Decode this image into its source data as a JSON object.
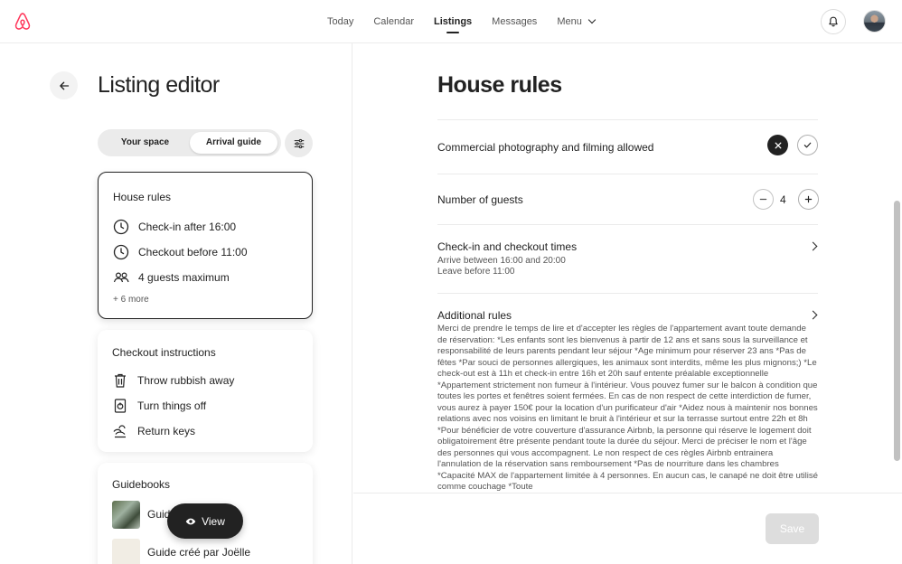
{
  "topbar": {
    "nav": [
      {
        "label": "Today",
        "active": false
      },
      {
        "label": "Calendar",
        "active": false
      },
      {
        "label": "Listings",
        "active": true
      },
      {
        "label": "Messages",
        "active": false
      },
      {
        "label": "Menu",
        "active": false
      }
    ],
    "logo_icon": "airbnb-logo-icon",
    "brand_color": "#FF385C",
    "bell_icon": "bell-icon"
  },
  "left": {
    "title": "Listing editor",
    "tabs": {
      "your_space": "Your space",
      "arrival_guide": "Arrival guide",
      "selected": "Arrival guide"
    },
    "house_rules_card": {
      "title": "House rules",
      "items": [
        {
          "icon": "clock-icon",
          "label": "Check-in after 16:00"
        },
        {
          "icon": "clock-icon",
          "label": "Checkout before 11:00"
        },
        {
          "icon": "guests-icon",
          "label": "4 guests maximum"
        }
      ],
      "more": "+ 6 more"
    },
    "checkout_card": {
      "title": "Checkout instructions",
      "items": [
        {
          "icon": "trash-icon",
          "label": "Throw rubbish away"
        },
        {
          "icon": "power-icon",
          "label": "Turn things off"
        },
        {
          "icon": "keys-icon",
          "label": "Return keys"
        }
      ]
    },
    "guidebooks_card": {
      "title": "Guidebooks",
      "items": [
        {
          "label": "Guid"
        },
        {
          "label": "Guide créé par Joëlle"
        }
      ]
    },
    "view_button": "View"
  },
  "right": {
    "title": "House rules",
    "photography": {
      "label": "Commercial photography and filming allowed",
      "value": "not allowed"
    },
    "guests": {
      "label": "Number of guests",
      "value": "4"
    },
    "times": {
      "label": "Check-in and checkout times",
      "line1": "Arrive between 16:00 and 20:00",
      "line2": "Leave before 11:00"
    },
    "additional": {
      "label": "Additional rules",
      "text": "Merci de prendre le temps de lire et d'accepter les règles de l'appartement avant toute demande de réservation: *Les enfants sont les bienvenus à partir de 12 ans et sans sous la surveillance et responsabilité de leurs parents pendant leur séjour *Age minimum pour réserver 23 ans *Pas de fêtes *Par souci de personnes allergiques, les animaux sont interdits, même les plus mignons;) *Le check-out est à 11h et check-in entre 16h et 20h sauf entente préalable exceptionnelle *Appartement strictement non fumeur à l'intérieur. Vous pouvez fumer sur le balcon à condition que toutes les portes et fenêtres soient fermées. En cas de non respect de cette interdiction de fumer, vous aurez à payer 150€ pour la location d'un purificateur d'air *Aidez nous à maintenir nos bonnes relations avec nos voisins en limitant le bruit à l'intérieur et sur la terrasse surtout entre 22h et 8h *Pour bénéficier de votre couverture d'assurance Airbnb, la personne qui réserve le logement doit obligatoirement être présente pendant toute la durée du séjour. Merci de préciser le nom et l'âge des personnes qui vous accompagnent. Le non respect de ces règles Airbnb entrainera l'annulation de la réservation sans remboursement *Pas de nourriture dans les chambres *Capacité MAX de l'appartement limitée à 4 personnes. En aucun cas, le canapé ne doit être utilisé comme couchage *Toute"
    },
    "save_button": "Save"
  }
}
